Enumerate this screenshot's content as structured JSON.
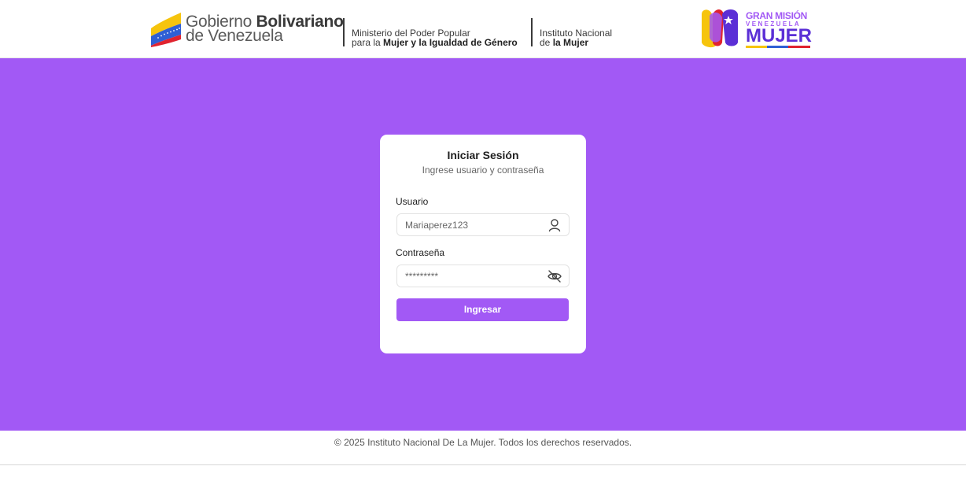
{
  "header": {
    "gov": {
      "line1_light": "Gobierno ",
      "line1_bold": "Bolivariano",
      "line2": "de Venezuela"
    },
    "ministry": {
      "line1": "Ministerio del Poder Popular",
      "line2_prefix": "para la ",
      "line2_bold": "Mujer y la Igualdad de Género"
    },
    "institute": {
      "line1": "Instituto Nacional",
      "line2_prefix": "de ",
      "line2_bold": "la Mujer"
    },
    "mision": {
      "line1": "GRAN MISIÓN",
      "line2": "VENEZUELA",
      "line3": "MUJER"
    }
  },
  "login": {
    "title": "Iniciar Sesión",
    "subtitle": "Ingrese usuario y contraseña",
    "user_label": "Usuario",
    "user_value": "Mariaperez123",
    "password_label": "Contraseña",
    "password_value": "*********",
    "submit_label": "Ingresar"
  },
  "footer": {
    "text": "© 2025 Instituto Nacional De La Mujer. Todos los derechos reservados."
  },
  "icons": {
    "user_field": "user-icon",
    "password_field": "eye-off-icon"
  },
  "colors": {
    "accent": "#a259f5",
    "brand_dark": "#5b2fd6"
  }
}
